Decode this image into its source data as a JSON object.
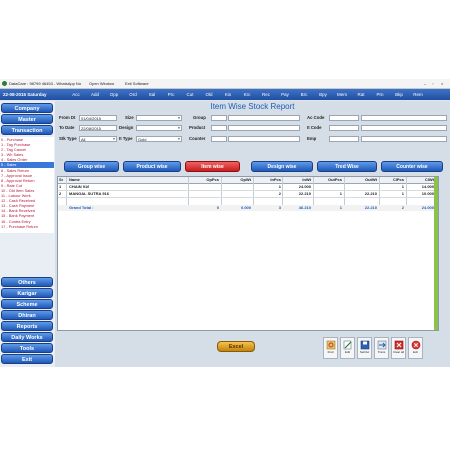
{
  "menubar": {
    "items": [
      "DataCare : 98799 46453 - WhatsApp No",
      "Open Window",
      "Exit Software"
    ],
    "window_controls": [
      "–",
      "▫",
      "×"
    ]
  },
  "navbar": {
    "date": "22-08-2015 Saturday",
    "items": [
      "Acc",
      "Add",
      "Opp",
      "Ord",
      "Sal",
      "Prc",
      "Cut",
      "Old",
      "Kis",
      "Krc",
      "Rec",
      "Pay",
      "Brc",
      "Bpy",
      "Mem",
      "Rat",
      "Prn",
      "Bkp",
      "Rem"
    ]
  },
  "sidebar": {
    "top_buttons": [
      "Company",
      "Master",
      "Transaction"
    ],
    "transaction_items": [
      "0 - Purchase",
      "1 - Tag Purchase",
      "2 - Tag Cancel",
      "3 - Wh Sales",
      "4 - Sales Order",
      "5 - Sales",
      "6 - Sales Return",
      "7 - Approval Issue",
      "8 - Approval Return",
      "9 - Rate Cut",
      "10 - Old Item Sales",
      "11 - Labour Work",
      "12 - Cash Received",
      "13 - Cash Payment",
      "14 - Bank Received",
      "15 - Bank Payment",
      "16 - Contra Entry",
      "17 - Purchase Return"
    ],
    "selected_index": 5,
    "bottom_buttons": [
      "Others",
      "Karigar",
      "Scheme",
      "Dhiran",
      "Reports",
      "Daily Works",
      "Tools",
      "Exit"
    ]
  },
  "report": {
    "title": "Item Wise Stock Report",
    "fields": {
      "from_dt_label": "From Dt",
      "from_dt_value": "01/04/2015",
      "to_date_label": "To Date",
      "to_date_value": "22/08/2015",
      "stk_type_label": "Stk Type",
      "stk_type_value": "All",
      "size_label": "Size",
      "design_label": "Design",
      "it_type_label": "It Type",
      "it_type_value": "Gold",
      "group_label": "Group",
      "product_label": "Product",
      "counter_label": "Counter",
      "ac_code_label": "Ac Code",
      "it_code_label": "It Code",
      "emp_label": "Emp"
    },
    "tabs": [
      "Group wise",
      "Product wise",
      "Item wise",
      "Design wise",
      "Tred Wise",
      "Counter wise"
    ],
    "active_tab": 2,
    "columns": [
      "Sr",
      "Name",
      "OpPcs",
      "OpWt",
      "InPcs",
      "InWt",
      "OutPcs",
      "OutWt",
      "ClPcs",
      "ClWt"
    ],
    "rows": [
      {
        "sr": "1",
        "name": "CHAIN 916",
        "op_pcs": "",
        "op_wt": "",
        "in_pcs": "1",
        "in_wt": "24.000",
        "out_pcs": "",
        "out_wt": "",
        "cl_pcs": "1",
        "cl_wt": "14.000"
      },
      {
        "sr": "2",
        "name": "MANGAL SUTRA 916",
        "op_pcs": "",
        "op_wt": "",
        "in_pcs": "2",
        "in_wt": "22.210",
        "out_pcs": "1",
        "out_wt": "22.210",
        "cl_pcs": "1",
        "cl_wt": "10.000"
      }
    ],
    "total": {
      "label": "Grand Total :",
      "op_pcs": "0",
      "op_wt": "0.000",
      "in_pcs": "3",
      "in_wt": "46.210",
      "out_pcs": "1",
      "out_wt": "22.210",
      "cl_pcs": "2",
      "cl_wt": "24.000"
    }
  },
  "bottom": {
    "excel_label": "Excel",
    "actions": [
      "Find",
      "Edit",
      "SetOut",
      "Trans",
      "Clear all",
      "Exit"
    ]
  },
  "colors": {
    "accent": "#1f59b8",
    "active_tab": "#c81e1e",
    "list_text": "#b3183a",
    "excel": "#f5c24a"
  }
}
